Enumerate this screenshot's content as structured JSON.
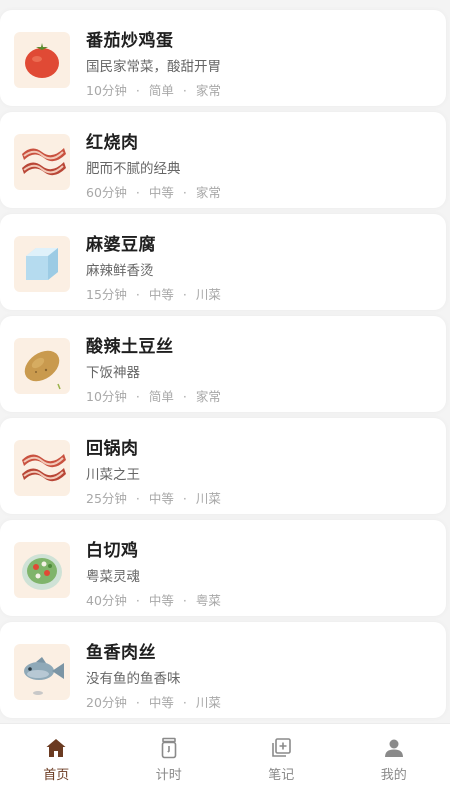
{
  "recipes": [
    {
      "title": "番茄炒鸡蛋",
      "desc": "国民家常菜，酸甜开胃",
      "time": "10分钟",
      "difficulty": "简单",
      "category": "家常",
      "image_icon": "tomato-icon"
    },
    {
      "title": "红烧肉",
      "desc": "肥而不腻的经典",
      "time": "60分钟",
      "difficulty": "中等",
      "category": "家常",
      "image_icon": "bacon-icon"
    },
    {
      "title": "麻婆豆腐",
      "desc": "麻辣鲜香烫",
      "time": "15分钟",
      "difficulty": "中等",
      "category": "川菜",
      "image_icon": "ice-cube-icon"
    },
    {
      "title": "酸辣土豆丝",
      "desc": "下饭神器",
      "time": "10分钟",
      "difficulty": "简单",
      "category": "家常",
      "image_icon": "potato-icon"
    },
    {
      "title": "回锅肉",
      "desc": "川菜之王",
      "time": "25分钟",
      "difficulty": "中等",
      "category": "川菜",
      "image_icon": "bacon-icon"
    },
    {
      "title": "白切鸡",
      "desc": "粤菜灵魂",
      "time": "40分钟",
      "difficulty": "中等",
      "category": "粤菜",
      "image_icon": "salad-icon"
    },
    {
      "title": "鱼香肉丝",
      "desc": "没有鱼的鱼香味",
      "time": "20分钟",
      "difficulty": "中等",
      "category": "川菜",
      "image_icon": "fish-icon"
    }
  ],
  "separator": "·",
  "tabs": [
    {
      "label": "首页",
      "icon": "home-icon",
      "active": true
    },
    {
      "label": "计时",
      "icon": "timer-icon",
      "active": false
    },
    {
      "label": "笔记",
      "icon": "notes-icon",
      "active": false
    },
    {
      "label": "我的",
      "icon": "person-icon",
      "active": false
    }
  ],
  "colors": {
    "accent": "#6b3b22",
    "inactive": "#8a8a8a",
    "thumb_bg": "#fbefe3"
  }
}
